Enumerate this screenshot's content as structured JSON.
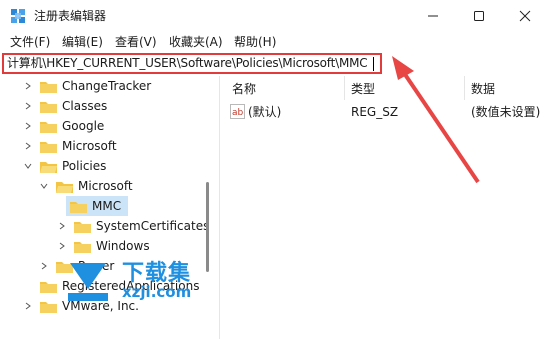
{
  "window": {
    "title": "注册表编辑器",
    "icon": "regedit-icon"
  },
  "menu": {
    "items": [
      "文件(F)",
      "编辑(E)",
      "查看(V)",
      "收藏夹(A)",
      "帮助(H)"
    ]
  },
  "address": {
    "path": "计算机\\HKEY_CURRENT_USER\\Software\\Policies\\Microsoft\\MMC"
  },
  "tree": {
    "items": [
      {
        "label": "ChangeTracker",
        "level": 1,
        "expanded": false
      },
      {
        "label": "Classes",
        "level": 1,
        "expanded": false
      },
      {
        "label": "Google",
        "level": 1,
        "expanded": false
      },
      {
        "label": "Microsoft",
        "level": 1,
        "expanded": false
      },
      {
        "label": "Policies",
        "level": 1,
        "expanded": true
      },
      {
        "label": "Microsoft",
        "level": 2,
        "expanded": true
      },
      {
        "label": "MMC",
        "level": 3,
        "selected": true
      },
      {
        "label": "SystemCertificates",
        "level": 3,
        "expanded": false
      },
      {
        "label": "Windows",
        "level": 3,
        "expanded": false
      },
      {
        "label": "Power",
        "level": 2,
        "expanded": false
      },
      {
        "label": "RegisteredApplications",
        "level": 1
      },
      {
        "label": "VMware, Inc.",
        "level": 1,
        "expanded": false
      }
    ]
  },
  "list": {
    "headers": [
      "名称",
      "类型",
      "数据"
    ],
    "rows": [
      {
        "name": "(默认)",
        "type": "REG_SZ",
        "data": "(数值未设置)"
      }
    ]
  },
  "watermark": {
    "line1": "下载集",
    "line2": "xzji.com"
  },
  "colors": {
    "accent_red": "#e23b3b",
    "selection": "#cce4f7",
    "folder": "#f4c542",
    "watermark_blue": "#1f8fe0"
  }
}
